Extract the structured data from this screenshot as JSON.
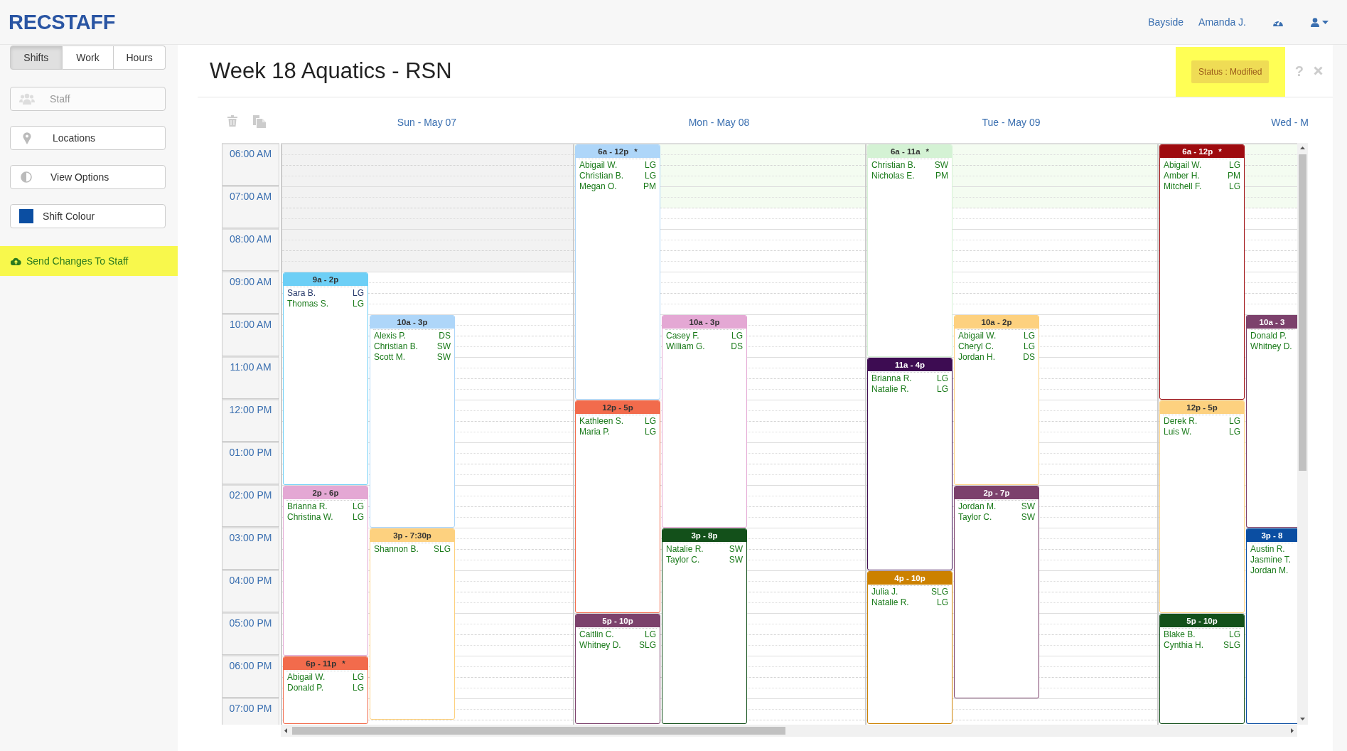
{
  "brand": "RECSTAFF",
  "nav": [
    {
      "label": "Bayside"
    },
    {
      "label": "Amanda J."
    }
  ],
  "view_tabs": [
    {
      "label": "Shifts",
      "selected": true
    },
    {
      "label": "Work",
      "selected": false
    },
    {
      "label": "Hours",
      "selected": false
    }
  ],
  "sidebar_buttons": [
    {
      "label": "Staff",
      "kind": "staff",
      "disabled": true
    },
    {
      "label": "Locations",
      "kind": "locations",
      "disabled": false
    },
    {
      "label": "View Options",
      "kind": "view",
      "disabled": false
    },
    {
      "label": "Shift Colour",
      "kind": "swatch",
      "disabled": false,
      "color": "#0b4ea2"
    }
  ],
  "send_button": {
    "label": "Send Changes To Staff"
  },
  "title": "Week 18 Aquatics - RSN",
  "status": "Status : Modified",
  "help": "?",
  "time_slots": [
    "06:00 AM",
    "07:00 AM",
    "08:00 AM",
    "09:00 AM",
    "10:00 AM",
    "11:00 AM",
    "12:00 PM",
    "01:00 PM",
    "02:00 PM",
    "03:00 PM",
    "04:00 PM",
    "05:00 PM",
    "06:00 PM",
    "07:00 PM"
  ],
  "days": [
    {
      "label": "Sun - May 07",
      "shifts": [
        {
          "time": "9a - 2p",
          "color": "#6dcff6",
          "staff": [
            {
              "name": "Sara B.",
              "role": "LG",
              "color": "#25386a"
            },
            {
              "name": "Thomas S.",
              "role": "LG",
              "color": "#1a7a1a"
            }
          ]
        },
        {
          "time": "2p - 6p",
          "color": "#e4a8d4",
          "staff": [
            {
              "name": "Brianna R.",
              "role": "LG",
              "color": "#1a7a1a"
            },
            {
              "name": "Christina W.",
              "role": "LG",
              "color": "#1a7a1a"
            }
          ]
        },
        {
          "time": "6p - 11p",
          "mark": "*",
          "color": "#f26b4c",
          "staff": [
            {
              "name": "Abigail W.",
              "role": "LG",
              "color": "#1a7a1a"
            },
            {
              "name": "Donald P.",
              "role": "LG",
              "color": "#1a7a1a"
            }
          ]
        },
        {
          "time": "10a - 3p",
          "color": "#aed6f9",
          "staff": [
            {
              "name": "Alexis P.",
              "role": "DS",
              "color": "#1a7a1a"
            },
            {
              "name": "Christian B.",
              "role": "SW",
              "color": "#1a7a1a"
            },
            {
              "name": "Scott M.",
              "role": "SW",
              "color": "#1a7a1a"
            }
          ]
        },
        {
          "time": "3p - 7:30p",
          "color": "#fdd17f",
          "staff": [
            {
              "name": "Shannon B.",
              "role": "SLG",
              "color": "#1a7a1a"
            }
          ]
        }
      ]
    },
    {
      "label": "Mon - May 08",
      "shifts": [
        {
          "time": "6a - 12p",
          "mark": "*",
          "color": "#aed6f9",
          "staff": [
            {
              "name": "Abigail W.",
              "role": "LG",
              "color": "#1a7a1a"
            },
            {
              "name": "Christian B.",
              "role": "LG",
              "color": "#1a7a1a"
            },
            {
              "name": "Megan O.",
              "role": "PM",
              "color": "#1a7a1a"
            }
          ]
        },
        {
          "time": "12p - 5p",
          "color": "#f26b4c",
          "staff": [
            {
              "name": "Kathleen S.",
              "role": "LG",
              "color": "#1a7a1a"
            },
            {
              "name": "Maria P.",
              "role": "LG",
              "color": "#1a7a1a"
            }
          ]
        },
        {
          "time": "5p - 10p",
          "color": "#7c416c",
          "staff": [
            {
              "name": "Caitlin C.",
              "role": "LG",
              "color": "#1a7a1a"
            },
            {
              "name": "Whitney D.",
              "role": "SLG",
              "color": "#1a7a1a"
            }
          ]
        },
        {
          "time": "10a - 3p",
          "color": "#e4a8d4",
          "staff": [
            {
              "name": "Casey F.",
              "role": "LG",
              "color": "#1a7a1a"
            },
            {
              "name": "William G.",
              "role": "DS",
              "color": "#1a7a1a"
            }
          ]
        },
        {
          "time": "3p - 8p",
          "color": "#13501a",
          "staff": [
            {
              "name": "Natalie R.",
              "role": "SW",
              "color": "#1a7a1a"
            },
            {
              "name": "Taylor C.",
              "role": "SW",
              "color": "#1a7a1a"
            }
          ]
        }
      ]
    },
    {
      "label": "Tue - May 09",
      "shifts": [
        {
          "time": "6a - 11a",
          "mark": "*",
          "color": "#d4f2d4",
          "staff": [
            {
              "name": "Christian B.",
              "role": "SW",
              "color": "#1a7a1a"
            },
            {
              "name": "Nicholas E.",
              "role": "PM",
              "color": "#1a7a1a"
            }
          ]
        },
        {
          "time": "11a - 4p",
          "color": "#3d0c52",
          "staff": [
            {
              "name": "Brianna R.",
              "role": "LG",
              "color": "#1a7a1a"
            },
            {
              "name": "Natalie R.",
              "role": "LG",
              "color": "#1a7a1a"
            }
          ]
        },
        {
          "time": "4p - 10p",
          "color": "#cc8100",
          "staff": [
            {
              "name": "Julia J.",
              "role": "SLG",
              "color": "#1a7a1a"
            },
            {
              "name": "Natalie R.",
              "role": "LG",
              "color": "#1a7a1a"
            }
          ]
        },
        {
          "time": "10a - 2p",
          "color": "#fdd17f",
          "staff": [
            {
              "name": "Abigail W.",
              "role": "LG",
              "color": "#1a7a1a"
            },
            {
              "name": "Cheryl C.",
              "role": "LG",
              "color": "#1a7a1a"
            },
            {
              "name": "Jordan H.",
              "role": "DS",
              "color": "#1a7a1a"
            }
          ]
        },
        {
          "time": "2p - 7p",
          "color": "#7c416c",
          "staff": [
            {
              "name": "Jordan M.",
              "role": "SW",
              "color": "#1a7a1a"
            },
            {
              "name": "Taylor C.",
              "role": "SW",
              "color": "#1a7a1a"
            }
          ]
        }
      ]
    },
    {
      "label": "Wed - M",
      "shifts": [
        {
          "time": "6a - 12p",
          "mark": "*",
          "color": "#9e0b0f",
          "staff": [
            {
              "name": "Abigail W.",
              "role": "LG",
              "color": "#1a7a1a"
            },
            {
              "name": "Amber H.",
              "role": "PM",
              "color": "#1a7a1a"
            },
            {
              "name": "Mitchell F.",
              "role": "LG",
              "color": "#1a7a1a"
            }
          ]
        },
        {
          "time": "12p - 5p",
          "color": "#fdd17f",
          "staff": [
            {
              "name": "Derek R.",
              "role": "LG",
              "color": "#1a7a1a"
            },
            {
              "name": "Luis W.",
              "role": "LG",
              "color": "#1a7a1a"
            }
          ]
        },
        {
          "time": "5p - 10p",
          "color": "#13501a",
          "staff": [
            {
              "name": "Blake B.",
              "role": "LG",
              "color": "#1a7a1a"
            },
            {
              "name": "Cynthia H.",
              "role": "SLG",
              "color": "#1a7a1a"
            }
          ]
        },
        {
          "time": "10a - 3",
          "color": "#7c416c",
          "staff": [
            {
              "name": "Donald P.",
              "color": "#1a7a1a"
            },
            {
              "name": "Whitney D.",
              "color": "#1a7a1a"
            }
          ]
        },
        {
          "time": "3p - 8",
          "color": "#0b4ea2",
          "staff": [
            {
              "name": "Austin R.",
              "color": "#1a7a1a"
            },
            {
              "name": "Jasmine T.",
              "color": "#1a7a1a"
            },
            {
              "name": "Jordan M.",
              "color": "#1a7a1a"
            }
          ]
        }
      ]
    }
  ]
}
